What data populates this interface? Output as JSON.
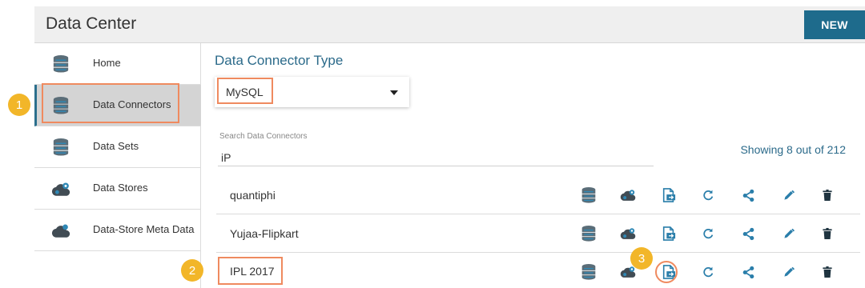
{
  "header": {
    "title": "Data Center",
    "new_label": "NEW"
  },
  "sidebar": {
    "items": [
      {
        "label": "Home",
        "icon": "database-icon"
      },
      {
        "label": "Data Connectors",
        "icon": "database-icon",
        "active": true
      },
      {
        "label": "Data Sets",
        "icon": "database-icon"
      },
      {
        "label": "Data Stores",
        "icon": "cloud-gear-icon"
      },
      {
        "label": "Data-Store Meta Data",
        "icon": "cloud-icon"
      }
    ]
  },
  "main": {
    "title": "Data Connector Type",
    "connector_type": {
      "selected": "MySQL"
    },
    "search": {
      "label": "Search Data Connectors",
      "value": "iP"
    },
    "showing_text": "Showing 8 out of 212",
    "rows": [
      {
        "name": "quantiphi"
      },
      {
        "name": "Yujaa-Flipkart"
      },
      {
        "name": "IPL 2017"
      }
    ],
    "row_actions": [
      "database-icon",
      "cloud-gear-icon",
      "import-document-icon",
      "refresh-icon",
      "share-icon",
      "edit-icon",
      "delete-icon"
    ]
  },
  "markers": {
    "m1": "1",
    "m2": "2",
    "m3": "3"
  },
  "colors": {
    "accent": "#2b6a8a",
    "button": "#1e6b8c",
    "highlight": "#ef8a5f",
    "marker": "#f2b629"
  }
}
